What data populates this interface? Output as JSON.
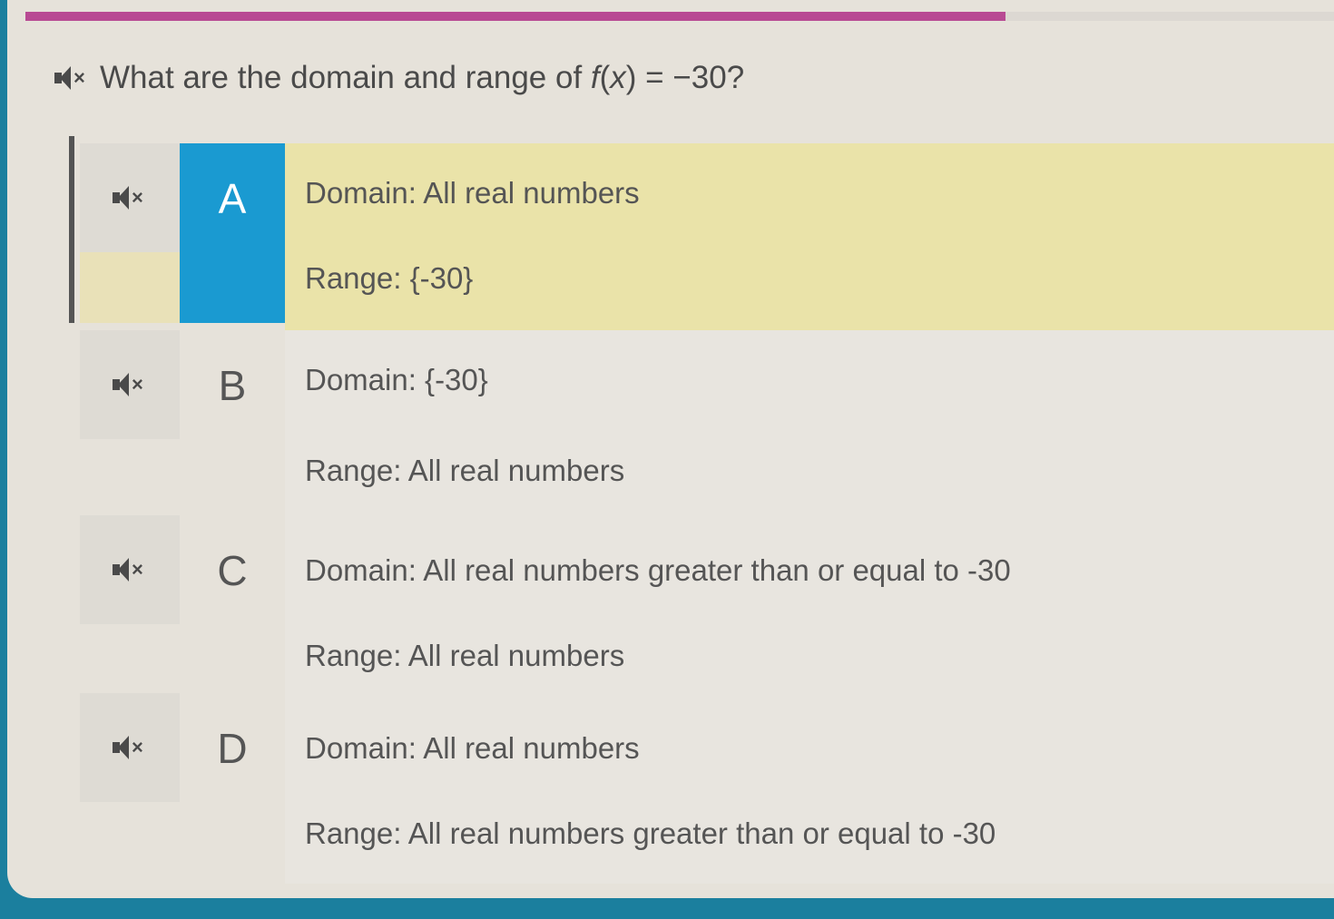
{
  "progress": {
    "fill_fraction": 0.745,
    "fill_color": "#b84a93"
  },
  "question": {
    "prefix": "What are the domain and range of ",
    "func": "f",
    "var": "x",
    "suffix": " = −30?"
  },
  "colors": {
    "selected_letter_bg": "#1a9ad1",
    "selected_row_bg": "#eae3a9"
  },
  "options": [
    {
      "letter": "A",
      "domain": "Domain: All real numbers",
      "range": "Range: {-30}",
      "selected": true
    },
    {
      "letter": "B",
      "domain": "Domain: {-30}",
      "range": "Range: All real numbers",
      "selected": false
    },
    {
      "letter": "C",
      "domain": "Domain: All real numbers greater than or equal to -30",
      "range": "Range: All real numbers",
      "selected": false
    },
    {
      "letter": "D",
      "domain": "Domain: All real numbers",
      "range": "Range: All real numbers greater than or equal to -30",
      "selected": false
    }
  ],
  "icons": {
    "audio": "speaker-muted-icon"
  }
}
